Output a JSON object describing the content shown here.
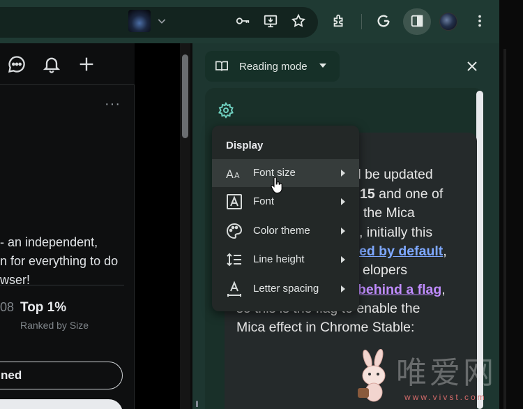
{
  "browser": {
    "toolbar_icons": [
      "key-icon",
      "install-app-icon",
      "star-icon",
      "extensions-icon",
      "google-icon",
      "side-panel-icon",
      "profile-avatar",
      "more-menu-icon"
    ]
  },
  "page": {
    "header_icons": [
      "chat-icon",
      "bell-icon",
      "plus-icon",
      "avatar",
      "chevron-down-icon"
    ],
    "more": "···",
    "text_lines": [
      "- an independent,",
      "n for everything to do",
      "wser!"
    ],
    "muted_fragment": "08",
    "rank_title": "Top 1%",
    "rank_subtitle": "Ranked by Size",
    "button_label": "ned"
  },
  "side_panel": {
    "mode_label": "Reading mode",
    "close": "✕",
    "reader_lines": {
      "l1": "ll be updated",
      "l2a": "15",
      "l2b": " and one of",
      "l3": "the Mica",
      "l4": ", initially this",
      "l5_link": "ed by default",
      "l5_tail": ",",
      "l6": "elopers",
      "l7_link": "behind a flag",
      "l7_tail": ",",
      "l8": "so this is the flag to enable the",
      "l9": "Mica effect in Chrome Stable:"
    }
  },
  "menu": {
    "heading": "Display",
    "items": [
      {
        "label": "Font size",
        "icon": "font-size-icon"
      },
      {
        "label": "Font",
        "icon": "font-icon"
      },
      {
        "label": "Color theme",
        "icon": "palette-icon"
      },
      {
        "label": "Line height",
        "icon": "line-height-icon"
      },
      {
        "label": "Letter spacing",
        "icon": "letter-spacing-icon"
      }
    ],
    "hovered_index": 0
  },
  "watermark": {
    "text": "唯爱网",
    "url": "www.vivst.com"
  },
  "colors": {
    "toolbar": "#1f3a33",
    "panel": "#1d3630",
    "accent_gear": "#6fd0c0",
    "link_blue": "#7ea8ff",
    "link_purple": "#c08cff"
  }
}
